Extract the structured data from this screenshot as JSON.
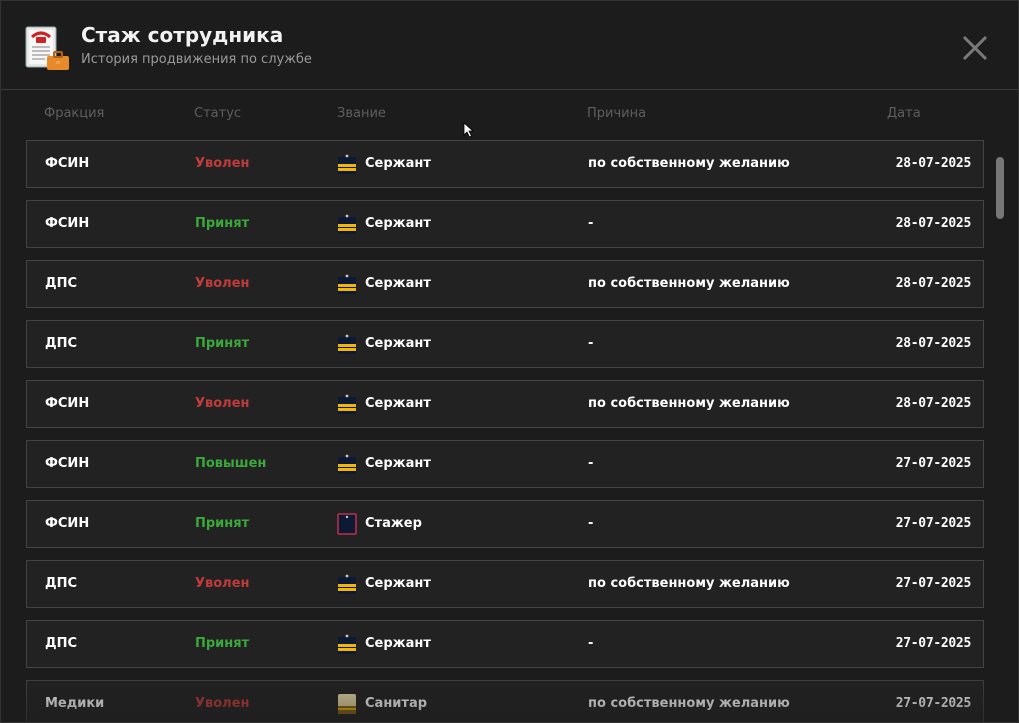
{
  "header": {
    "title": "Стаж сотрудника",
    "subtitle": "История продвижения по службе"
  },
  "columns": {
    "faction": "Фракция",
    "status": "Статус",
    "rank": "Звание",
    "reason": "Причина",
    "date": "Дата"
  },
  "rows": [
    {
      "faction": "ФСИН",
      "status": "Уволен",
      "status_type": "fired",
      "rank": "Сержант",
      "rank_icon": "sergeant-insignia-icon",
      "reason": "по собственному желанию",
      "date": "28-07-2025"
    },
    {
      "faction": "ФСИН",
      "status": "Принят",
      "status_type": "hired",
      "rank": "Сержант",
      "rank_icon": "sergeant-insignia-icon",
      "reason": "-",
      "date": "28-07-2025"
    },
    {
      "faction": "ДПС",
      "status": "Уволен",
      "status_type": "fired",
      "rank": "Сержант",
      "rank_icon": "sergeant-insignia-icon",
      "reason": "по собственному желанию",
      "date": "28-07-2025"
    },
    {
      "faction": "ДПС",
      "status": "Принят",
      "status_type": "hired",
      "rank": "Сержант",
      "rank_icon": "sergeant-insignia-icon",
      "reason": "-",
      "date": "28-07-2025"
    },
    {
      "faction": "ФСИН",
      "status": "Уволен",
      "status_type": "fired",
      "rank": "Сержант",
      "rank_icon": "sergeant-insignia-icon",
      "reason": "по собственному желанию",
      "date": "28-07-2025"
    },
    {
      "faction": "ФСИН",
      "status": "Повышен",
      "status_type": "promoted",
      "rank": "Сержант",
      "rank_icon": "sergeant-insignia-icon",
      "reason": "-",
      "date": "27-07-2025"
    },
    {
      "faction": "ФСИН",
      "status": "Принят",
      "status_type": "hired",
      "rank": "Стажер",
      "rank_icon": "trainee-insignia-icon",
      "reason": "-",
      "date": "27-07-2025"
    },
    {
      "faction": "ДПС",
      "status": "Уволен",
      "status_type": "fired",
      "rank": "Сержант",
      "rank_icon": "sergeant-insignia-icon",
      "reason": "по собственному желанию",
      "date": "27-07-2025"
    },
    {
      "faction": "ДПС",
      "status": "Принят",
      "status_type": "hired",
      "rank": "Сержант",
      "rank_icon": "sergeant-insignia-icon",
      "reason": "-",
      "date": "27-07-2025"
    },
    {
      "faction": "Медики",
      "status": "Уволен",
      "status_type": "fired",
      "rank": "Санитар",
      "rank_icon": "medic-insignia-icon",
      "reason": "по собственному желанию",
      "date": "27-07-2025"
    }
  ],
  "colors": {
    "fired": "#c23b3b",
    "hired": "#3aa83a",
    "gold": "#f2b705",
    "navy": "#0d1a36"
  }
}
